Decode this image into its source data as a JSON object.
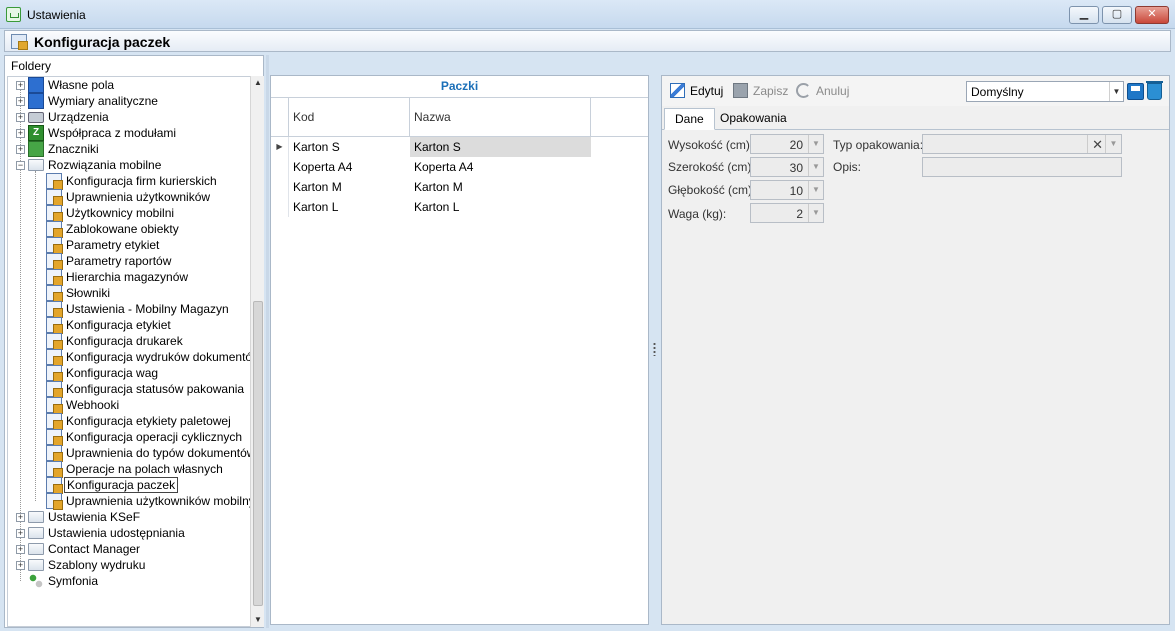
{
  "window": {
    "title": "Ustawienia",
    "minimize_icon": "minimize-icon",
    "maximize_icon": "maximize-icon",
    "close_icon": "close-icon"
  },
  "header": {
    "title": "Konfiguracja paczek"
  },
  "folders": {
    "caption": "Foldery",
    "items": [
      {
        "label": "Własne pola",
        "icon": "blue-doc-icon",
        "level": 0,
        "expander": "+"
      },
      {
        "label": "Wymiary analityczne",
        "icon": "blue-doc-icon",
        "level": 0,
        "expander": "+"
      },
      {
        "label": "Urządzenia",
        "icon": "printer-icon",
        "level": 0,
        "expander": "+"
      },
      {
        "label": "Współpraca z modułami",
        "icon": "green-z-icon",
        "level": 0,
        "expander": "+"
      },
      {
        "label": "Znaczniki",
        "icon": "tag-icon",
        "level": 0,
        "expander": "+"
      },
      {
        "label": "Rozwiązania mobilne",
        "icon": "folder-icon",
        "level": 0,
        "expander": "-"
      },
      {
        "label": "Konfiguracja firm kurierskich",
        "icon": "config-icon",
        "level": 1
      },
      {
        "label": "Uprawnienia użytkowników",
        "icon": "config-icon",
        "level": 1
      },
      {
        "label": "Użytkownicy mobilni",
        "icon": "config-icon",
        "level": 1
      },
      {
        "label": "Zablokowane obiekty",
        "icon": "config-icon",
        "level": 1
      },
      {
        "label": "Parametry etykiet",
        "icon": "config-icon",
        "level": 1
      },
      {
        "label": "Parametry raportów",
        "icon": "config-icon",
        "level": 1
      },
      {
        "label": "Hierarchia magazynów",
        "icon": "config-icon",
        "level": 1
      },
      {
        "label": "Słowniki",
        "icon": "config-icon",
        "level": 1
      },
      {
        "label": "Ustawienia - Mobilny Magazyn",
        "icon": "config-icon",
        "level": 1
      },
      {
        "label": "Konfiguracja etykiet",
        "icon": "config-icon",
        "level": 1
      },
      {
        "label": "Konfiguracja drukarek",
        "icon": "config-icon",
        "level": 1
      },
      {
        "label": "Konfiguracja wydruków dokumentów",
        "icon": "config-icon",
        "level": 1
      },
      {
        "label": "Konfiguracja wag",
        "icon": "config-icon",
        "level": 1
      },
      {
        "label": "Konfiguracja statusów pakowania",
        "icon": "config-icon",
        "level": 1
      },
      {
        "label": "Webhooki",
        "icon": "config-icon",
        "level": 1
      },
      {
        "label": "Konfiguracja etykiety paletowej",
        "icon": "config-icon",
        "level": 1
      },
      {
        "label": "Konfiguracja operacji cyklicznych",
        "icon": "config-icon",
        "level": 1
      },
      {
        "label": "Uprawnienia do typów dokumentów",
        "icon": "config-icon",
        "level": 1
      },
      {
        "label": "Operacje na polach własnych",
        "icon": "config-icon",
        "level": 1
      },
      {
        "label": "Konfiguracja paczek",
        "icon": "config-icon",
        "level": 1,
        "selected": true
      },
      {
        "label": "Uprawnienia użytkowników mobilnych",
        "icon": "config-icon",
        "level": 1
      },
      {
        "label": "Ustawienia KSeF",
        "icon": "folder-icon",
        "level": 0,
        "expander": "+"
      },
      {
        "label": "Ustawienia udostępniania",
        "icon": "folder-icon",
        "level": 0,
        "expander": "+"
      },
      {
        "label": "Contact Manager",
        "icon": "folder-icon",
        "level": 0,
        "expander": "+"
      },
      {
        "label": "Szablony wydruku",
        "icon": "folder-icon",
        "level": 0,
        "expander": "+"
      },
      {
        "label": "Symfonia",
        "icon": "symfonia-icon",
        "level": 0
      }
    ]
  },
  "grid": {
    "title": "Paczki",
    "columns": [
      "Kod",
      "Nazwa"
    ],
    "rows": [
      {
        "kod": "Karton S",
        "nazwa": "Karton S",
        "current": true
      },
      {
        "kod": "Koperta A4",
        "nazwa": "Koperta A4"
      },
      {
        "kod": "Karton M",
        "nazwa": "Karton M"
      },
      {
        "kod": "Karton L",
        "nazwa": "Karton L"
      }
    ]
  },
  "toolbar": {
    "edit_label": "Edytuj",
    "save_label": "Zapisz",
    "cancel_label": "Anuluj",
    "layout_value": "Domyślny"
  },
  "tabs": {
    "dane": "Dane",
    "opakowania": "Opakowania"
  },
  "form": {
    "height_label": "Wysokość (cm):",
    "height_value": "20",
    "width_label": "Szerokość (cm):",
    "width_value": "30",
    "depth_label": "Głębokość (cm):",
    "depth_value": "10",
    "weight_label": "Waga (kg):",
    "weight_value": "2",
    "package_type_label": "Typ opakowania:",
    "package_type_value": "",
    "description_label": "Opis:",
    "description_value": ""
  }
}
